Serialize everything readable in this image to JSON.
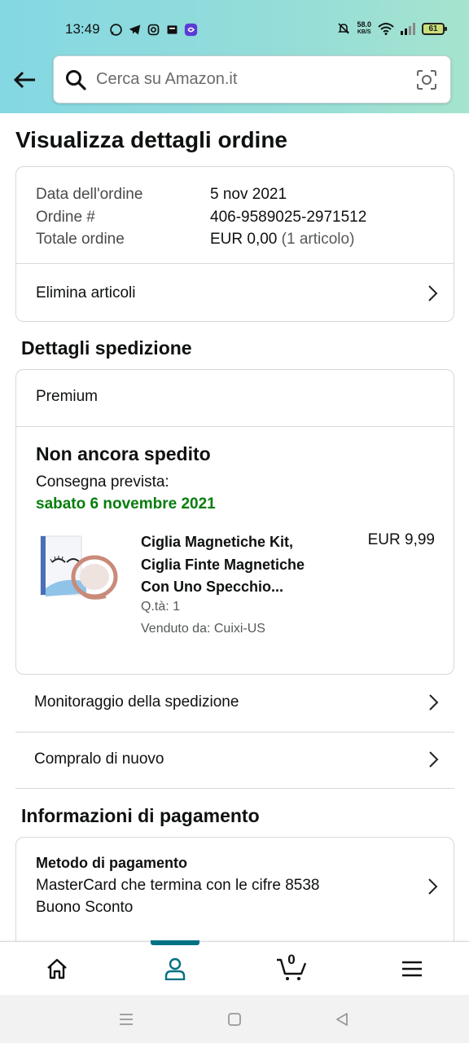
{
  "status_bar": {
    "time": "13:49",
    "net_speed_value": "58.0",
    "net_speed_unit": "KB/S",
    "battery": "61",
    "app_icons": [
      "whatsapp-icon",
      "telegram-icon",
      "instagram-icon",
      "book-icon",
      "link-app-icon"
    ]
  },
  "search": {
    "placeholder": "Cerca su Amazon.it"
  },
  "page": {
    "title": "Visualizza dettagli ordine"
  },
  "order": {
    "rows": [
      {
        "label": "Data dell'ordine",
        "value": "5 nov 2021"
      },
      {
        "label": "Ordine #",
        "value": "406-9589025-2971512"
      },
      {
        "label": "Totale ordine",
        "value": "EUR 0,00",
        "extra": "(1 articolo)"
      }
    ],
    "delete_items_label": "Elimina articoli"
  },
  "shipping": {
    "section_title": "Dettagli spedizione",
    "service": "Premium",
    "status": "Non ancora spedito",
    "delivery_label": "Consegna prevista:",
    "delivery_date": "sabato 6 novembre 2021",
    "product": {
      "title_line1": "Ciglia Magnetiche Kit,",
      "title_line2": "Ciglia Finte Magnetiche",
      "title_line3": "Con Uno Specchio...",
      "price": "EUR 9,99",
      "qty": "Q.tà: 1",
      "seller": "Venduto da: Cuixi-US"
    },
    "track_label": "Monitoraggio della spedizione",
    "buy_again_label": "Compralo di nuovo"
  },
  "payment": {
    "section_title": "Informazioni di pagamento",
    "method_title": "Metodo di pagamento",
    "card_line": "MasterCard che termina con le cifre 8538",
    "voucher_line": "Buono Sconto"
  },
  "bottom_nav": {
    "items": [
      "home-icon",
      "account-icon",
      "cart-icon",
      "menu-icon"
    ],
    "active": "account-icon",
    "cart_count": "0"
  },
  "colors": {
    "accent": "#007185",
    "delivery_green": "#067d0c",
    "header_gradient_start": "#84d8e3",
    "header_gradient_end": "#a5e4ce"
  }
}
